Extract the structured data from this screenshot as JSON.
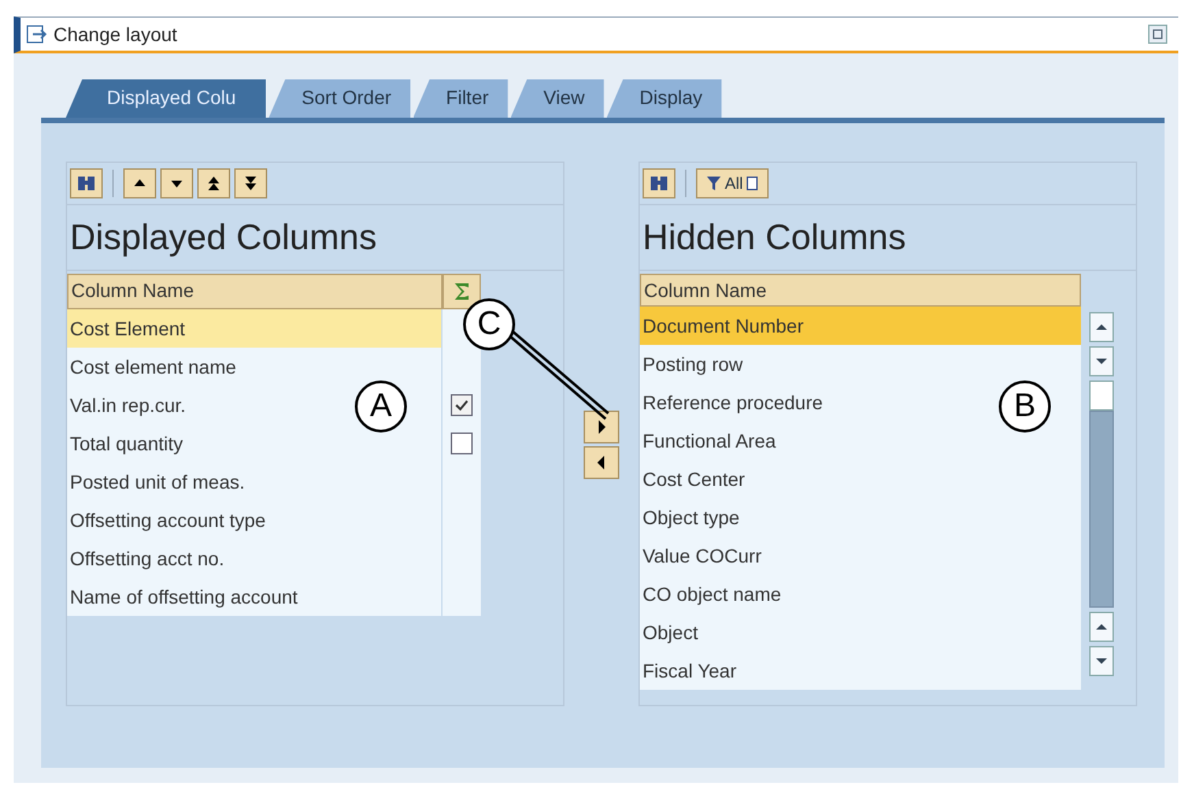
{
  "window": {
    "title": "Change layout"
  },
  "tabs": [
    {
      "label": "Displayed Colu",
      "selected": true
    },
    {
      "label": "Sort Order",
      "selected": false
    },
    {
      "label": "Filter",
      "selected": false
    },
    {
      "label": "View",
      "selected": false
    },
    {
      "label": "Display",
      "selected": false
    }
  ],
  "displayed_columns": {
    "title": "Displayed Columns",
    "focused": false,
    "header": "Column Name",
    "rows": [
      {
        "label": "Cost Element",
        "selected": true,
        "kind": "text"
      },
      {
        "label": "Cost element name",
        "selected": false,
        "kind": "text"
      },
      {
        "label": "Val.in rep.cur.",
        "selected": false,
        "kind": "checkbox",
        "checked": true
      },
      {
        "label": "Total quantity",
        "selected": false,
        "kind": "checkbox",
        "checked": false
      },
      {
        "label": "Posted unit of meas.",
        "selected": false,
        "kind": "text"
      },
      {
        "label": "Offsetting account type",
        "selected": false,
        "kind": "text"
      },
      {
        "label": "Offsetting acct no.",
        "selected": false,
        "kind": "text"
      },
      {
        "label": "Name of offsetting account",
        "selected": false,
        "kind": "text"
      }
    ]
  },
  "hidden_columns": {
    "title": "Hidden Columns",
    "focused": true,
    "filter_button": "All",
    "header": "Column Name",
    "rows": [
      {
        "label": "Document Number",
        "selected": true
      },
      {
        "label": "Posting row",
        "selected": false
      },
      {
        "label": "Reference procedure",
        "selected": false
      },
      {
        "label": "Functional Area",
        "selected": false
      },
      {
        "label": "Cost Center",
        "selected": false
      },
      {
        "label": "Object type",
        "selected": false
      },
      {
        "label": "Value COCurr",
        "selected": false
      },
      {
        "label": "CO object name",
        "selected": false
      },
      {
        "label": "Object",
        "selected": false
      },
      {
        "label": "Fiscal Year",
        "selected": false
      }
    ]
  },
  "callouts": [
    {
      "label": "A"
    },
    {
      "label": "B"
    },
    {
      "label": "C"
    }
  ]
}
